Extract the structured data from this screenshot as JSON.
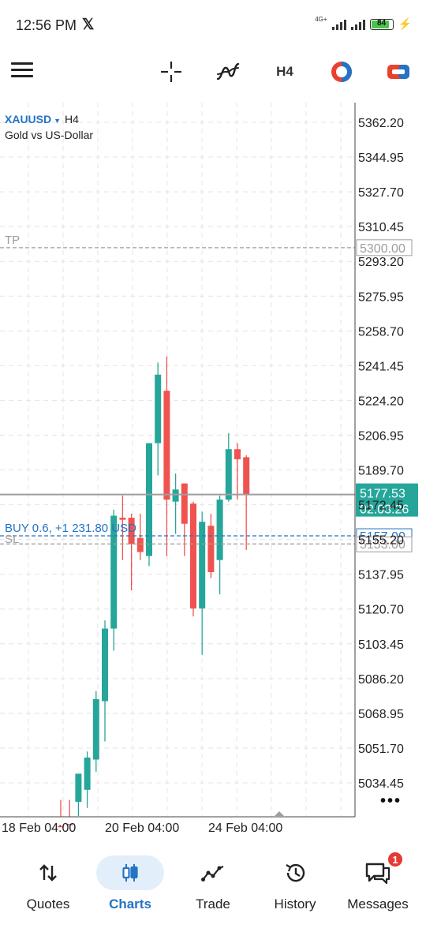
{
  "status": {
    "time": "12:56 PM",
    "x_logo": "𝕏",
    "network": "4G+",
    "battery": "84"
  },
  "toolbar": {
    "timeframe": "H4",
    "icons": [
      "menu-icon",
      "crosshair-icon",
      "indicators-icon",
      "timeframe",
      "one-click-trading-icon",
      "trade-toggle-icon"
    ]
  },
  "chart": {
    "symbol": "XAUUSD",
    "timeframe": "H4",
    "description": "Gold vs US-Dollar",
    "colors": {
      "bull": "#26a69a",
      "bear": "#ef5350",
      "grid": "#e4e4e4",
      "position_line": "#2473c4",
      "price_line": "#9e9e9e"
    }
  },
  "chart_data": {
    "type": "candlestick",
    "symbol": "XAUUSD",
    "timeframe": "H4",
    "ylim": [
      5023.2,
      5372.7
    ],
    "y_ticks": [
      "5362.20",
      "5344.95",
      "5327.70",
      "5310.45",
      "5293.20",
      "5275.95",
      "5258.70",
      "5241.45",
      "5224.20",
      "5206.95",
      "5189.70",
      "5172.45",
      "5155.20",
      "5137.95",
      "5120.70",
      "5103.45",
      "5086.20",
      "5068.95",
      "5051.70",
      "5034.45"
    ],
    "x_labels": [
      "18 Feb 04:00",
      "20 Feb 04:00",
      "24 Feb 04:00"
    ],
    "current_price": "5177.53",
    "bar_countdown": "02:03:26",
    "tp": {
      "label": "TP",
      "price": "5300.00"
    },
    "sl": {
      "label": "SL",
      "price": "5153.00"
    },
    "position": {
      "label": "BUY 0.6,  +1 231.80 USD",
      "price": "5157.00"
    },
    "candles": [
      {
        "o": 5013,
        "h": 5026,
        "l": 5005,
        "c": 5011
      },
      {
        "o": 5014,
        "h": 5026,
        "l": 5006,
        "c": 5010
      },
      {
        "o": 5025,
        "h": 5037,
        "l": 5018,
        "c": 5039
      },
      {
        "o": 5031,
        "h": 5050,
        "l": 5022,
        "c": 5047
      },
      {
        "o": 5046,
        "h": 5080,
        "l": 5040,
        "c": 5076
      },
      {
        "o": 5075,
        "h": 5115,
        "l": 5055,
        "c": 5111
      },
      {
        "o": 5111,
        "h": 5170,
        "l": 5100,
        "c": 5167
      },
      {
        "o": 5166,
        "h": 5177,
        "l": 5145,
        "c": 5165
      },
      {
        "o": 5166,
        "h": 5168,
        "l": 5130,
        "c": 5153
      },
      {
        "o": 5156,
        "h": 5168,
        "l": 5145,
        "c": 5149
      },
      {
        "o": 5147,
        "h": 5203,
        "l": 5142,
        "c": 5203
      },
      {
        "o": 5203,
        "h": 5243,
        "l": 5187,
        "c": 5237
      },
      {
        "o": 5229,
        "h": 5246,
        "l": 5147,
        "c": 5175
      },
      {
        "o": 5174,
        "h": 5188,
        "l": 5158,
        "c": 5180
      },
      {
        "o": 5183,
        "h": 5183,
        "l": 5147,
        "c": 5163
      },
      {
        "o": 5173,
        "h": 5174,
        "l": 5117,
        "c": 5121
      },
      {
        "o": 5121,
        "h": 5169,
        "l": 5098,
        "c": 5164
      },
      {
        "o": 5162,
        "h": 5168,
        "l": 5136,
        "c": 5139
      },
      {
        "o": 5145,
        "h": 5177,
        "l": 5128,
        "c": 5175
      },
      {
        "o": 5175,
        "h": 5208,
        "l": 5174,
        "c": 5200
      },
      {
        "o": 5200,
        "h": 5203,
        "l": 5175,
        "c": 5195
      },
      {
        "o": 5196,
        "h": 5197,
        "l": 5150,
        "c": 5177.53
      }
    ]
  },
  "nav": {
    "quotes": "Quotes",
    "charts": "Charts",
    "trade": "Trade",
    "history": "History",
    "messages": "Messages",
    "messages_badge": "1"
  }
}
